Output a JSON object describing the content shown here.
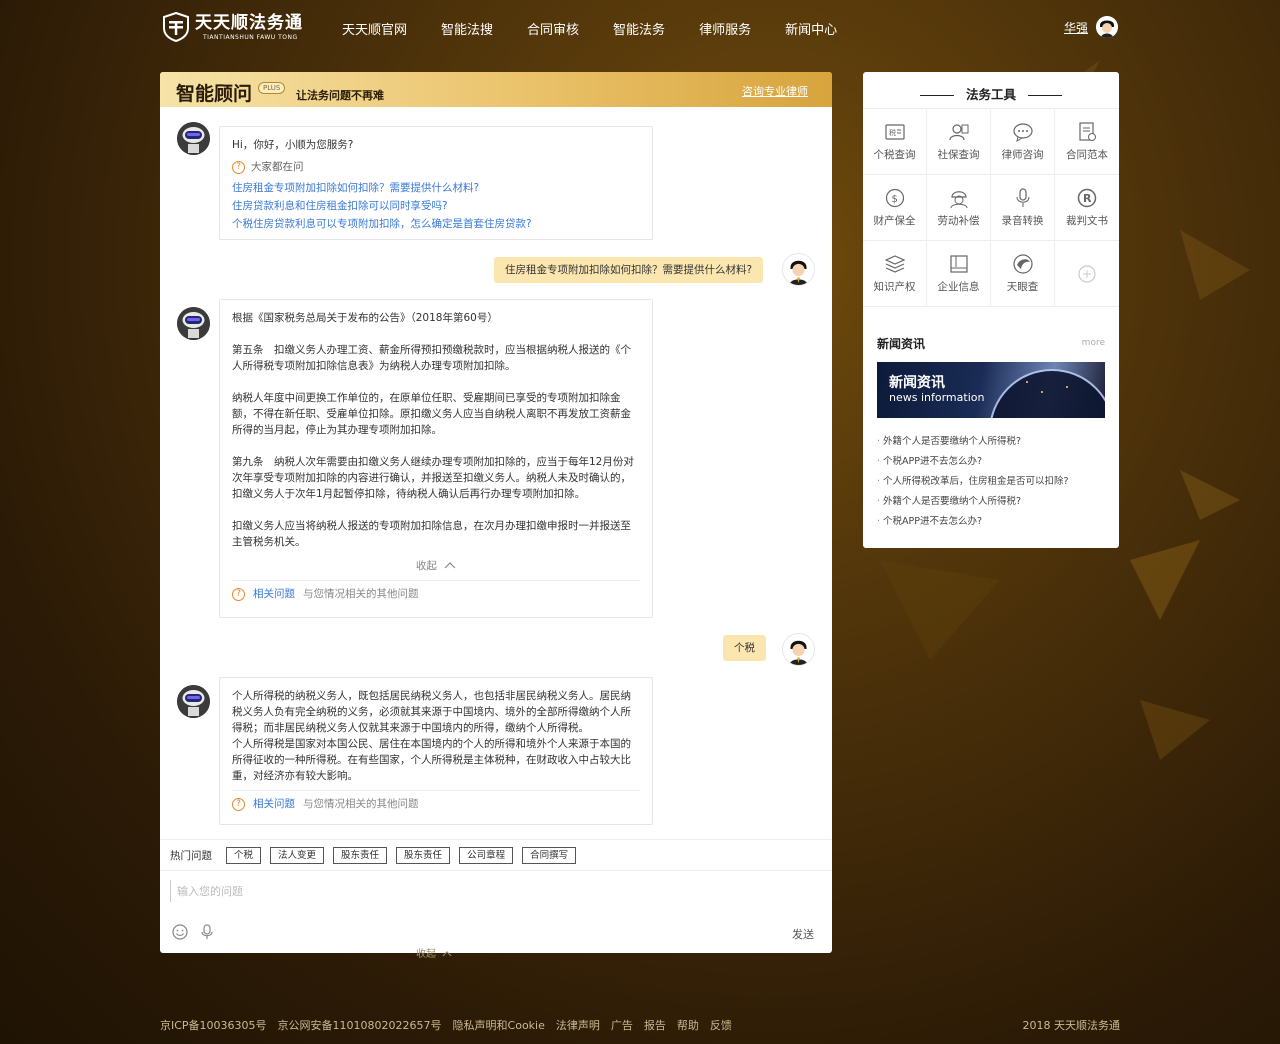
{
  "header": {
    "logo_cn": "天天顺法务通",
    "logo_en": "TIANTIANSHUN FAWU TONG",
    "nav": [
      "天天顺官网",
      "智能法搜",
      "合同审核",
      "智能法务",
      "律师服务",
      "新闻中心"
    ],
    "user_name": "华强"
  },
  "chat": {
    "title": "智能顾问",
    "badge": "PLUS",
    "subtitle": "让法务问题不再难",
    "consult_link": "咨询专业律师",
    "greeting": {
      "hello": "Hi，你好，小顺为您服务?",
      "asking_label": "大家都在问",
      "questions": [
        "住房租金专项附加扣除如何扣除？需要提供什么材料?",
        "住房贷款利息和住房租金扣除可以同时享受吗?",
        "个税住房贷款利息可以专项附加扣除，怎么确定是首套住房贷款?"
      ]
    },
    "user_msg_1": "住房租金专项附加扣除如何扣除？需要提供什么材料?",
    "answer_1": {
      "paragraphs": [
        "根据《国家税务总局关于发布的公告》（2018年第60号）",
        "第五条　扣缴义务人办理工资、薪金所得预扣预缴税款时，应当根据纳税人报送的《个人所得税专项附加扣除信息表》为纳税人办理专项附加扣除。",
        "纳税人年度中间更换工作单位的，在原单位任职、受雇期间已享受的专项附加扣除金额，不得在新任职、受雇单位扣除。原扣缴义务人应当自纳税人离职不再发放工资薪金所得的当月起，停止为其办理专项附加扣除。",
        "第九条　纳税人次年需要由扣缴义务人继续办理专项附加扣除的，应当于每年12月份对次年享受专项附加扣除的内容进行确认，并报送至扣缴义务人。纳税人未及时确认的，扣缴义务人于次年1月起暂停扣除，待纳税人确认后再行办理专项附加扣除。",
        "扣缴义务人应当将纳税人报送的专项附加扣除信息，在次月办理扣缴申报时一并报送至主管税务机关。"
      ],
      "collapse": "收起",
      "related_link": "相关问题",
      "related_desc": "与您情况相关的其他问题"
    },
    "user_msg_2": "个税",
    "answer_2": {
      "paragraphs": [
        "个人所得税的纳税义务人，既包括居民纳税义务人，也包括非居民纳税义务人。居民纳税义务人负有完全纳税的义务，必须就其来源于中国境内、境外的全部所得缴纳个人所得税；而非居民纳税义务人仅就其来源于中国境内的所得，缴纳个人所得税。",
        "个人所得税是国家对本国公民、居住在本国境内的个人的所得和境外个人来源于本国的所得征收的一种所得税。在有些国家，个人所得税是主体税种，在财政收入中占较大比重，对经济亦有较大影响。"
      ],
      "related_link": "相关问题",
      "related_desc": "与您情况相关的其他问题"
    },
    "hot_label": "热门问题",
    "hot_tags": [
      "个税",
      "法人变更",
      "股东责任",
      "股东责任",
      "公司章程",
      "合同撰写"
    ],
    "input_placeholder": "输入您的问题",
    "send": "发送"
  },
  "below_collapse": "收起",
  "sidebar": {
    "title": "法务工具",
    "tools": [
      {
        "label": "个税查询",
        "icon": "tax-icon"
      },
      {
        "label": "社保查询",
        "icon": "social-security-icon"
      },
      {
        "label": "律师咨询",
        "icon": "chat-bubbles-icon"
      },
      {
        "label": "合同范本",
        "icon": "contract-icon"
      },
      {
        "label": "财产保全",
        "icon": "money-icon"
      },
      {
        "label": "劳动补偿",
        "icon": "worker-icon"
      },
      {
        "label": "录音转换",
        "icon": "microphone-icon"
      },
      {
        "label": "裁判文书",
        "icon": "registered-icon"
      },
      {
        "label": "知识产权",
        "icon": "layers-icon"
      },
      {
        "label": "企业信息",
        "icon": "book-icon"
      },
      {
        "label": "天眼查",
        "icon": "eye-logo-icon"
      },
      {
        "label": "",
        "icon": "add-icon"
      }
    ],
    "news_title": "新闻资讯",
    "news_more": "more",
    "banner_cn": "新闻资讯",
    "banner_en": "news information",
    "news": [
      "外籍个人是否要缴纳个人所得税?",
      "个税APP进不去怎么办?",
      "个人所得税改革后，住房租金是否可以扣除?",
      "外籍个人是否要缴纳个人所得税?",
      "个税APP进不去怎么办?"
    ]
  },
  "footer": {
    "links": [
      "京ICP备10036305号",
      "京公网安备11010802022657号",
      "隐私声明和Cookie",
      "法律声明",
      "广告",
      "报告",
      "帮助",
      "反馈"
    ],
    "copyright": "2018 天天顺法务通"
  }
}
